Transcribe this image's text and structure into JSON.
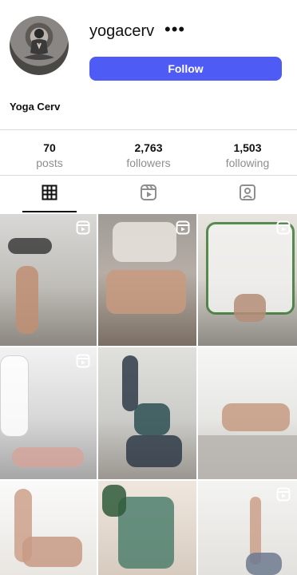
{
  "profile": {
    "username": "yogacerv",
    "more_label": "•••",
    "follow_label": "Follow",
    "display_name": "Yoga Cerv"
  },
  "stats": [
    {
      "value": "70",
      "label": "posts"
    },
    {
      "value": "2,763",
      "label": "followers"
    },
    {
      "value": "1,503",
      "label": "following"
    }
  ],
  "tabs": [
    {
      "icon": "grid-icon",
      "active": true
    },
    {
      "icon": "reels-icon",
      "active": false
    },
    {
      "icon": "tagged-icon",
      "active": false
    }
  ],
  "colors": {
    "follow_button": "#4f5bf5",
    "divider": "#dbdbdb",
    "muted_text": "#8e8e8e"
  },
  "posts": [
    {
      "id": "post-1",
      "reel": true
    },
    {
      "id": "post-2",
      "reel": true
    },
    {
      "id": "post-3",
      "reel": true
    },
    {
      "id": "post-4",
      "reel": true
    },
    {
      "id": "post-5",
      "reel": false
    },
    {
      "id": "post-6",
      "reel": false
    },
    {
      "id": "post-7",
      "reel": false
    },
    {
      "id": "post-8",
      "reel": false
    },
    {
      "id": "post-9",
      "reel": true
    }
  ]
}
